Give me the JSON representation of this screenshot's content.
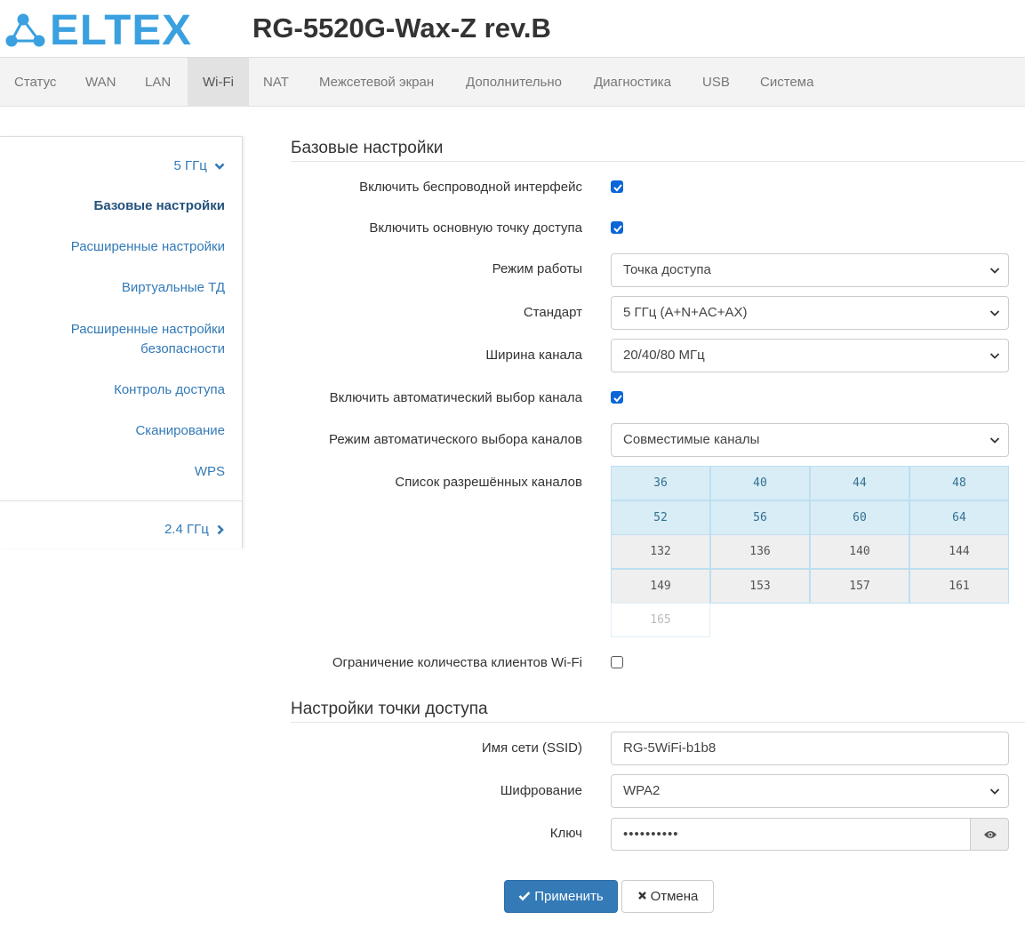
{
  "header": {
    "logo_text": "ELTEX",
    "model": "RG-5520G-Wax-Z rev.B",
    "brand_color": "#3aa0e0"
  },
  "topnav": {
    "tabs": [
      {
        "label": "Статус"
      },
      {
        "label": "WAN"
      },
      {
        "label": "LAN"
      },
      {
        "label": "Wi-Fi",
        "active": true
      },
      {
        "label": "NAT"
      },
      {
        "label": "Межсетевой экран"
      },
      {
        "label": "Дополнительно"
      },
      {
        "label": "Диагностика"
      },
      {
        "label": "USB"
      },
      {
        "label": "Система"
      }
    ]
  },
  "sidebar": {
    "band5": {
      "label": "5 ГГц",
      "icon": "chevron-down-icon"
    },
    "items": [
      {
        "label": "Базовые настройки",
        "active": true
      },
      {
        "label": "Расширенные настройки"
      },
      {
        "label": "Виртуальные ТД"
      },
      {
        "label_line1": "Расширенные настройки",
        "label_line2": "безопасности"
      },
      {
        "label": "Контроль доступа"
      },
      {
        "label": "Сканирование"
      },
      {
        "label": "WPS"
      }
    ],
    "band24": {
      "label": "2.4 ГГц",
      "icon": "chevron-right-icon"
    }
  },
  "basic": {
    "title": "Базовые настройки",
    "enable_wireless": {
      "label": "Включить беспроводной интерфейс",
      "checked": true
    },
    "enable_main_ap": {
      "label": "Включить основную точку доступа",
      "checked": true
    },
    "mode": {
      "label": "Режим работы",
      "value": "Точка доступа"
    },
    "standard": {
      "label": "Стандарт",
      "value": "5 ГГц (A+N+AC+AX)"
    },
    "channel_width": {
      "label": "Ширина канала",
      "value": "20/40/80 МГц"
    },
    "auto_channel": {
      "label": "Включить автоматический выбор канала",
      "checked": true
    },
    "auto_channel_mode": {
      "label": "Режим автоматического выбора каналов",
      "value": "Совместимые каналы"
    },
    "allowed_channels": {
      "label": "Список разрешённых каналов",
      "channels": [
        {
          "n": "36",
          "state": "selected"
        },
        {
          "n": "40",
          "state": "selected"
        },
        {
          "n": "44",
          "state": "selected"
        },
        {
          "n": "48",
          "state": "selected"
        },
        {
          "n": "52",
          "state": "selected"
        },
        {
          "n": "56",
          "state": "selected"
        },
        {
          "n": "60",
          "state": "selected"
        },
        {
          "n": "64",
          "state": "selected"
        },
        {
          "n": "132",
          "state": "normal"
        },
        {
          "n": "136",
          "state": "normal"
        },
        {
          "n": "140",
          "state": "normal"
        },
        {
          "n": "144",
          "state": "normal"
        },
        {
          "n": "149",
          "state": "normal"
        },
        {
          "n": "153",
          "state": "normal"
        },
        {
          "n": "157",
          "state": "normal"
        },
        {
          "n": "161",
          "state": "normal"
        },
        {
          "n": "165",
          "state": "disabled"
        }
      ]
    },
    "client_limit": {
      "label": "Ограничение количества клиентов Wi-Fi",
      "checked": false
    }
  },
  "ap": {
    "title": "Настройки точки доступа",
    "ssid": {
      "label": "Имя сети (SSID)",
      "value": "RG-5WiFi-b1b8"
    },
    "encryption": {
      "label": "Шифрование",
      "value": "WPA2"
    },
    "key": {
      "label": "Ключ",
      "value": "••••••••••"
    }
  },
  "actions": {
    "apply": "Применить",
    "cancel": "Отмена"
  },
  "colors": {
    "accent": "#337ab7",
    "checkbox": "#0a66d6",
    "channel_selected_bg": "#d9edf7"
  }
}
